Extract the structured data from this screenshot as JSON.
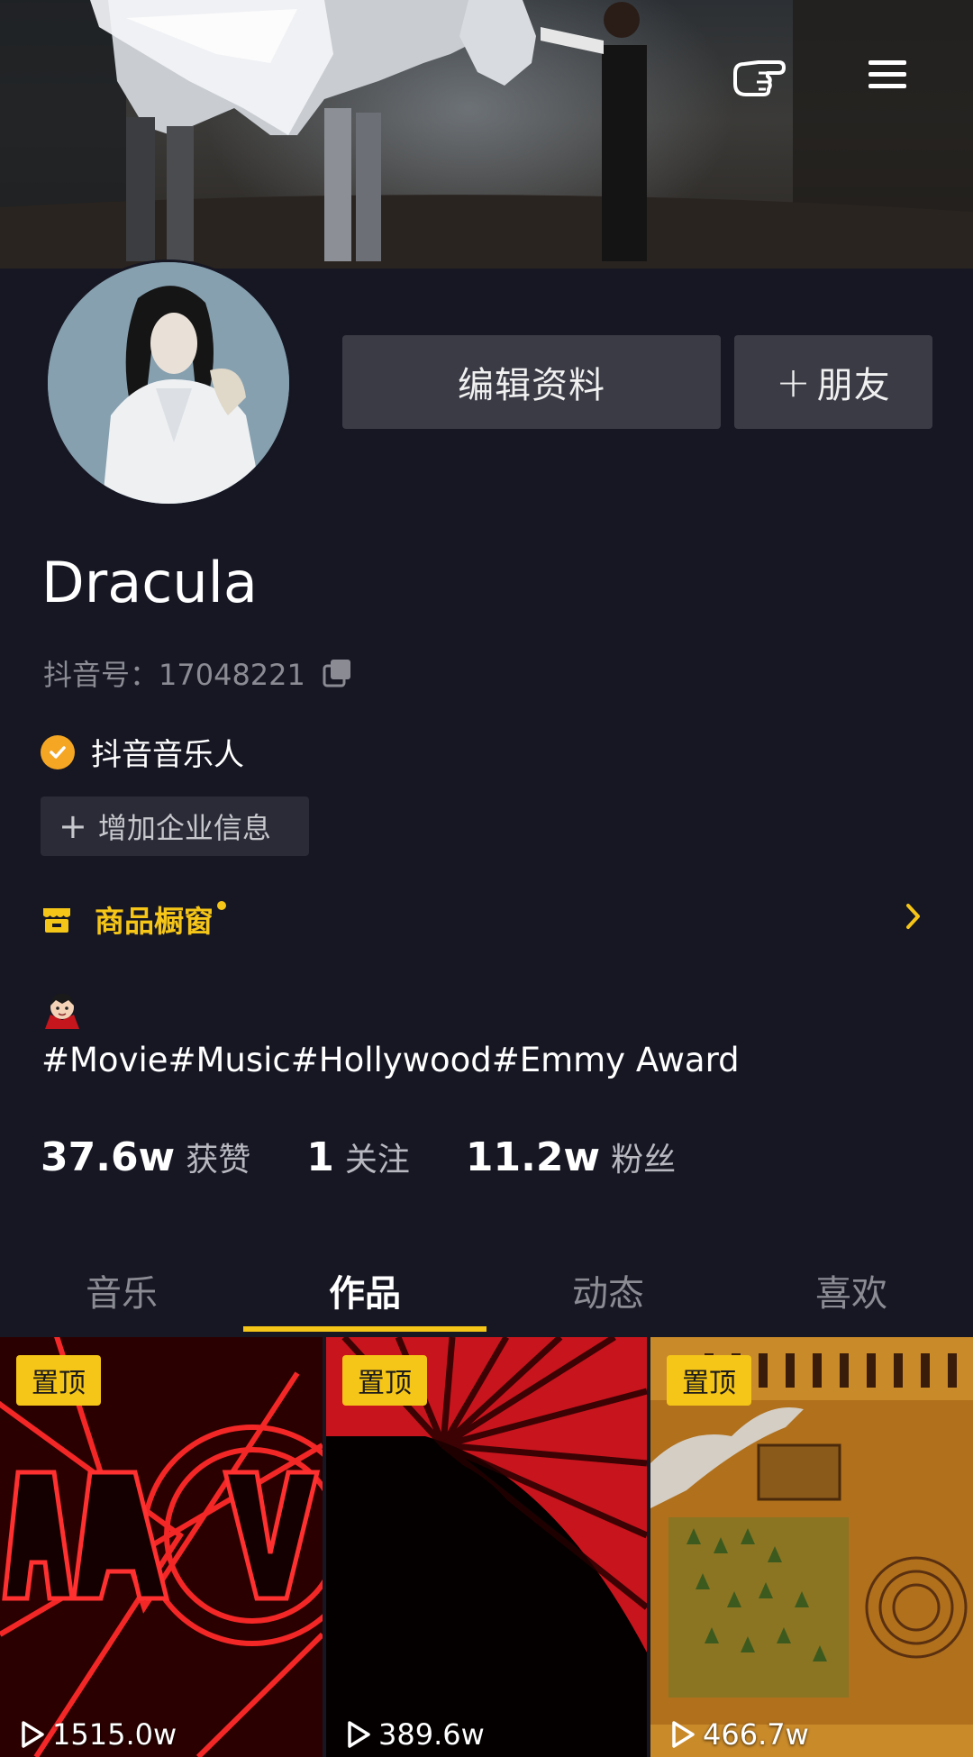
{
  "header": {
    "pointer_icon": "hand-pointer-icon",
    "menu_icon": "hamburger-menu-icon"
  },
  "profile": {
    "edit_label": "编辑资料",
    "add_friend_label": "朋友",
    "name": "Dracula",
    "douyin_id": "抖音号：17048221",
    "verified_label": "抖音音乐人",
    "add_business_label": "增加企业信息",
    "shop_label": "商品橱窗",
    "bio": "#Movie#Music#Hollywood#Emmy Award"
  },
  "stats": [
    {
      "value": "37.6w",
      "label": "获赞"
    },
    {
      "value": "1",
      "label": "关注"
    },
    {
      "value": "11.2w",
      "label": "粉丝"
    }
  ],
  "tabs": [
    {
      "label": "音乐"
    },
    {
      "label": "作品"
    },
    {
      "label": "动态"
    },
    {
      "label": "喜欢"
    }
  ],
  "active_tab_index": 1,
  "videos": [
    {
      "badge": "置顶",
      "plays": "1515.0w"
    },
    {
      "badge": "置顶",
      "plays": "389.6w"
    },
    {
      "badge": "置顶",
      "plays": "466.7w"
    }
  ],
  "colors": {
    "background": "#161723",
    "accent": "#f5c518",
    "verified": "#f5a623",
    "button": "#3a3b45"
  }
}
